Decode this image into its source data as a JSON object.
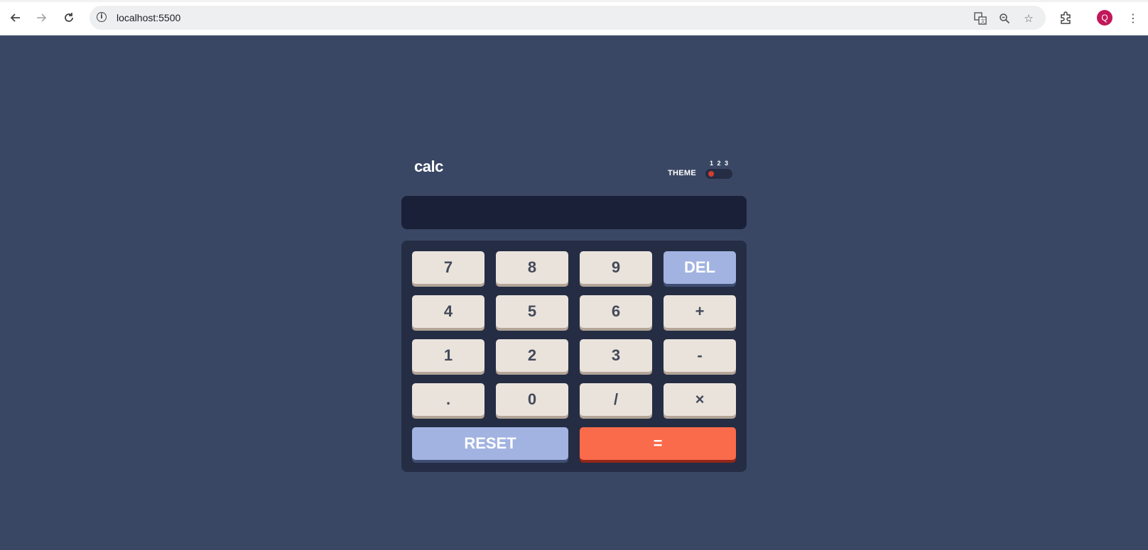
{
  "browser": {
    "url": "localhost:5500",
    "avatar_initial": "Q"
  },
  "calculator": {
    "title": "calc",
    "theme_label": "THEME",
    "theme_options": [
      "1",
      "2",
      "3"
    ],
    "selected_theme": 1,
    "display_value": "",
    "keys": {
      "k7": "7",
      "k8": "8",
      "k9": "9",
      "del": "DEL",
      "k4": "4",
      "k5": "5",
      "k6": "6",
      "plus": "+",
      "k1": "1",
      "k2": "2",
      "k3": "3",
      "minus": "-",
      "dot": ".",
      "k0": "0",
      "divide": "/",
      "multiply": "×",
      "reset": "RESET",
      "equals": "="
    }
  },
  "colors": {
    "background": "#3a4764",
    "keypad": "#242d44",
    "screen": "#1a2037",
    "key": "#eae3dc",
    "key_blue": "#a2b3e1",
    "key_red": "#f96b4b",
    "toggle_knob": "#d03f2f"
  },
  "icons": [
    "back-arrow-icon",
    "forward-arrow-icon",
    "reload-icon",
    "info-icon",
    "translate-icon",
    "zoom-icon",
    "bookmark-star-icon",
    "extensions-icon",
    "menu-kebab-icon"
  ]
}
